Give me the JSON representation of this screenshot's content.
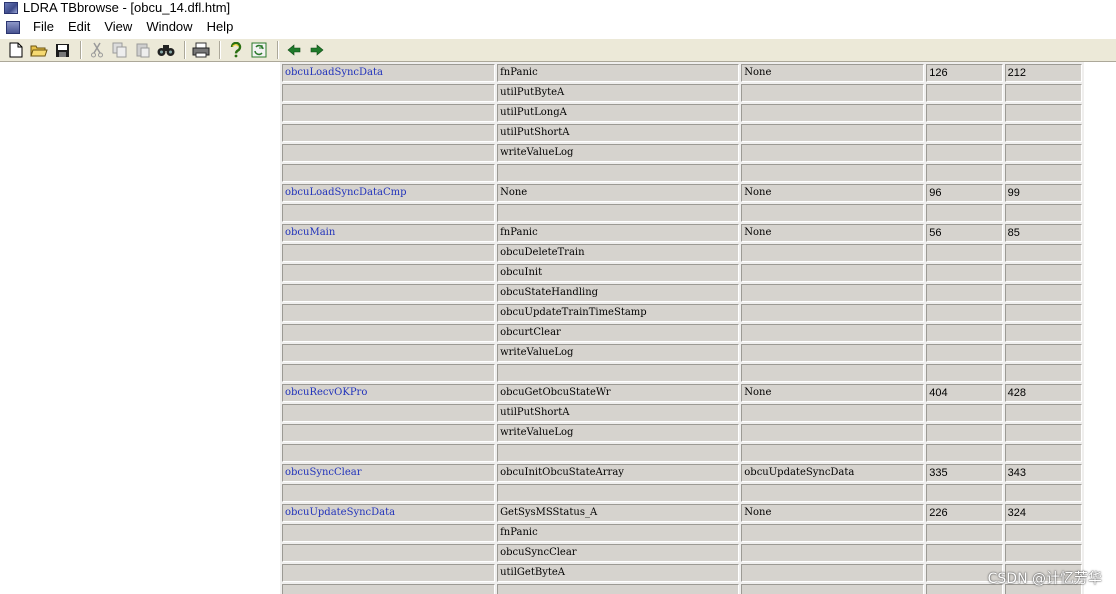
{
  "window": {
    "title": "LDRA TBbrowse - [obcu_14.dfl.htm]",
    "menu": [
      "File",
      "Edit",
      "View",
      "Window",
      "Help"
    ]
  },
  "toolbar": {
    "icons": [
      "new-file-icon",
      "open-folder-icon",
      "save-icon",
      "cut-icon",
      "copy-icon",
      "paste-icon",
      "find-icon",
      "print-icon",
      "help-icon",
      "refresh-icon",
      "back-arrow-icon",
      "forward-arrow-icon"
    ]
  },
  "table": {
    "rows": [
      [
        "obcuLoadSyncData",
        "fnPanic",
        "None",
        "126",
        "212"
      ],
      [
        "",
        "utilPutByteA",
        "",
        "",
        ""
      ],
      [
        "",
        "utilPutLongA",
        "",
        "",
        ""
      ],
      [
        "",
        "utilPutShortA",
        "",
        "",
        ""
      ],
      [
        "",
        "writeValueLog",
        "",
        "",
        ""
      ],
      [
        "",
        "",
        "",
        "",
        ""
      ],
      [
        "obcuLoadSyncDataCmp",
        "None",
        "None",
        "96",
        "99"
      ],
      [
        "",
        "",
        "",
        "",
        ""
      ],
      [
        "obcuMain",
        "fnPanic",
        "None",
        "56",
        "85"
      ],
      [
        "",
        "obcuDeleteTrain",
        "",
        "",
        ""
      ],
      [
        "",
        "obcuInit",
        "",
        "",
        ""
      ],
      [
        "",
        "obcuStateHandling",
        "",
        "",
        ""
      ],
      [
        "",
        "obcuUpdateTrainTimeStamp",
        "",
        "",
        ""
      ],
      [
        "",
        "obcurtClear",
        "",
        "",
        ""
      ],
      [
        "",
        "writeValueLog",
        "",
        "",
        ""
      ],
      [
        "",
        "",
        "",
        "",
        ""
      ],
      [
        "obcuRecvOKPro",
        "obcuGetObcuStateWr",
        "None",
        "404",
        "428"
      ],
      [
        "",
        "utilPutShortA",
        "",
        "",
        ""
      ],
      [
        "",
        "writeValueLog",
        "",
        "",
        ""
      ],
      [
        "",
        "",
        "",
        "",
        ""
      ],
      [
        "obcuSyncClear",
        "obcuInitObcuStateArray",
        "obcuUpdateSyncData",
        "335",
        "343"
      ],
      [
        "",
        "",
        "",
        "",
        ""
      ],
      [
        "obcuUpdateSyncData",
        "GetSysMSStatus_A",
        "None",
        "226",
        "324"
      ],
      [
        "",
        "fnPanic",
        "",
        "",
        ""
      ],
      [
        "",
        "obcuSyncClear",
        "",
        "",
        ""
      ],
      [
        "",
        "utilGetByteA",
        "",
        "",
        ""
      ],
      [
        "",
        "",
        "",
        "",
        ""
      ]
    ]
  },
  "watermark": "CSDN @计忆芳华"
}
